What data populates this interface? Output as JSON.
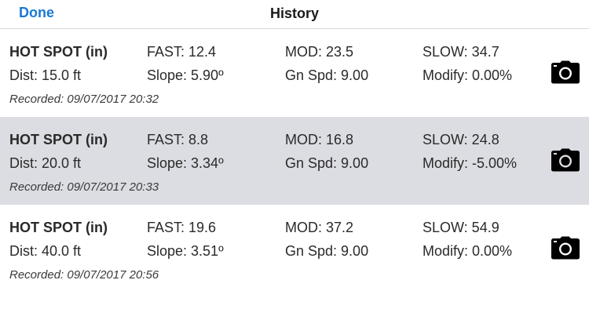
{
  "navbar": {
    "done_label": "Done",
    "title": "History"
  },
  "icons": {
    "camera": "camera-icon"
  },
  "colors": {
    "accent": "#1a78d6",
    "selected_row": "#dcdde2"
  },
  "records": [
    {
      "name": "HOT SPOT (in)",
      "fast": "FAST: 12.4",
      "mod": "MOD: 23.5",
      "slow": "SLOW: 34.7",
      "dist": "Dist: 15.0 ft",
      "slope": "Slope: 5.90º",
      "gn_spd": "Gn Spd: 9.00",
      "modify": "Modify: 0.00%",
      "recorded": "Recorded: 09/07/2017 20:32",
      "selected": false
    },
    {
      "name": "HOT SPOT (in)",
      "fast": "FAST: 8.8",
      "mod": "MOD: 16.8",
      "slow": "SLOW: 24.8",
      "dist": "Dist: 20.0 ft",
      "slope": "Slope: 3.34º",
      "gn_spd": "Gn Spd: 9.00",
      "modify": "Modify: -5.00%",
      "recorded": "Recorded: 09/07/2017 20:33",
      "selected": true
    },
    {
      "name": "HOT SPOT (in)",
      "fast": "FAST: 19.6",
      "mod": "MOD: 37.2",
      "slow": "SLOW: 54.9",
      "dist": "Dist: 40.0 ft",
      "slope": "Slope: 3.51º",
      "gn_spd": "Gn Spd: 9.00",
      "modify": "Modify: 0.00%",
      "recorded": "Recorded: 09/07/2017 20:56",
      "selected": false
    }
  ]
}
